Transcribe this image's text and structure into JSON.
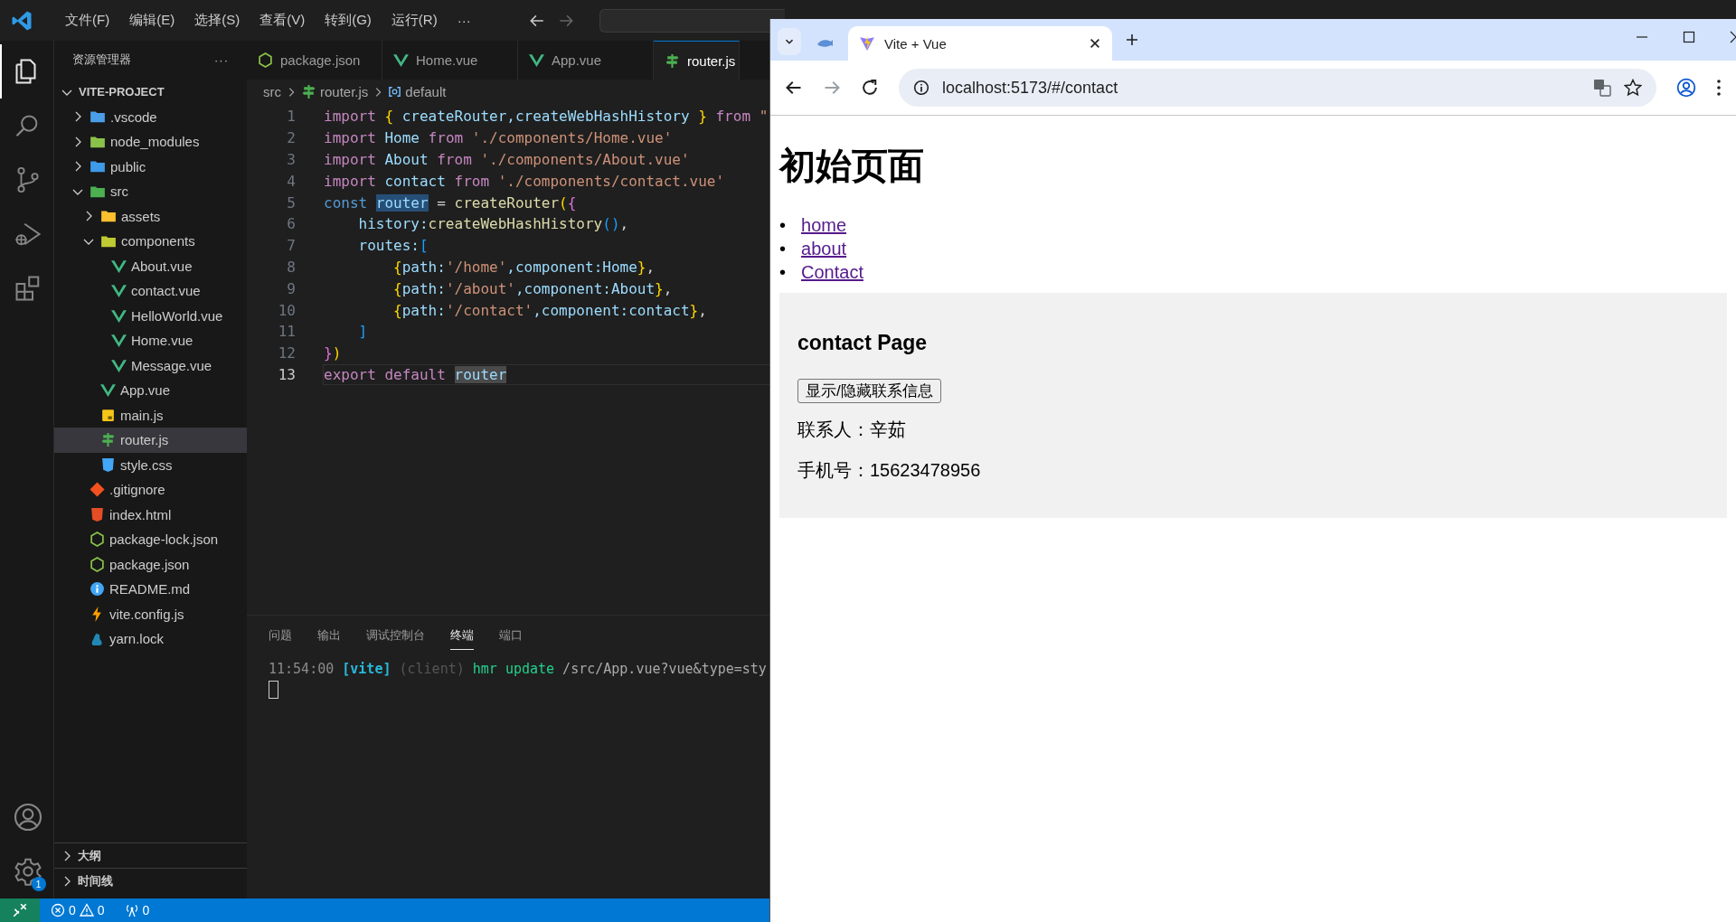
{
  "menu": {
    "items": [
      "文件(F)",
      "编辑(E)",
      "选择(S)",
      "查看(V)",
      "转到(G)",
      "运行(R)",
      "···"
    ]
  },
  "activity_bar": {
    "items": [
      {
        "selected": true
      },
      {
        "selected": false
      },
      {
        "selected": false
      },
      {
        "selected": false
      },
      {
        "selected": false
      }
    ],
    "settings_badge": "1"
  },
  "explorer": {
    "title": "资源管理器",
    "more": "···",
    "tree": {
      "label": "VITE-PROJECT",
      "kind": "folder",
      "expanded": true,
      "selected": false,
      "children": [
        {
          "label": ".vscode",
          "kind": "folder",
          "expanded": false,
          "selected": false
        },
        {
          "label": "node_modules",
          "kind": "folder",
          "expanded": false,
          "selected": false
        },
        {
          "label": "public",
          "kind": "folder",
          "expanded": false,
          "selected": false
        },
        {
          "label": "src",
          "kind": "folder",
          "expanded": true,
          "selected": false,
          "children": [
            {
              "label": "assets",
              "kind": "folder",
              "expanded": false,
              "selected": false
            },
            {
              "label": "components",
              "kind": "folder",
              "expanded": true,
              "selected": false,
              "children": [
                {
                  "label": "About.vue",
                  "kind": "vue",
                  "selected": false
                },
                {
                  "label": "contact.vue",
                  "kind": "vue",
                  "selected": false
                },
                {
                  "label": "HelloWorld.vue",
                  "kind": "vue",
                  "selected": false
                },
                {
                  "label": "Home.vue",
                  "kind": "vue",
                  "selected": false
                },
                {
                  "label": "Message.vue",
                  "kind": "vue",
                  "selected": false
                }
              ]
            },
            {
              "label": "App.vue",
              "kind": "vue",
              "selected": false
            },
            {
              "label": "main.js",
              "kind": "script",
              "selected": false
            },
            {
              "label": "router.js",
              "kind": "router",
              "selected": true
            },
            {
              "label": "style.css",
              "kind": "stylesheet",
              "selected": false
            }
          ]
        },
        {
          "label": ".gitignore",
          "kind": "git",
          "selected": false
        },
        {
          "label": "index.html",
          "kind": "html",
          "selected": false
        },
        {
          "label": "package-lock.json",
          "kind": "json",
          "selected": false
        },
        {
          "label": "package.json",
          "kind": "json",
          "selected": false
        },
        {
          "label": "README.md",
          "kind": "info",
          "selected": false
        },
        {
          "label": "vite.config.js",
          "kind": "config",
          "selected": false
        },
        {
          "label": "yarn.lock",
          "kind": "lockfile",
          "selected": false
        }
      ]
    },
    "sections": [
      {
        "label": "大纲",
        "expanded": false
      },
      {
        "label": "时间线",
        "expanded": false
      }
    ]
  },
  "editor": {
    "tabs": [
      {
        "label": "package.json",
        "kind": "json",
        "selected": false
      },
      {
        "label": "Home.vue",
        "kind": "vue",
        "selected": false
      },
      {
        "label": "App.vue",
        "kind": "vue",
        "selected": false
      },
      {
        "label": "router.js",
        "kind": "router",
        "selected": true
      }
    ],
    "breadcrumb": [
      {
        "label": "src",
        "kind": "path"
      },
      {
        "label": "router.js",
        "kind": "router"
      },
      {
        "label": "default",
        "kind": "symbol"
      }
    ],
    "lines": [
      {
        "number": "1",
        "current": false,
        "tokens": [
          {
            "text": "import ",
            "kind": "keyword"
          },
          {
            "text": "{ ",
            "kind": "bracket"
          },
          {
            "text": "createRouter,createWebHashHistory ",
            "kind": "variable"
          },
          {
            "text": "} ",
            "kind": "bracket"
          },
          {
            "text": "from ",
            "kind": "keyword"
          },
          {
            "text": "\"",
            "kind": "string"
          }
        ]
      },
      {
        "number": "2",
        "current": false,
        "tokens": [
          {
            "text": "import ",
            "kind": "keyword"
          },
          {
            "text": "Home ",
            "kind": "variable"
          },
          {
            "text": "from ",
            "kind": "keyword"
          },
          {
            "text": "'./components/Home.vue'",
            "kind": "string"
          }
        ]
      },
      {
        "number": "3",
        "current": false,
        "tokens": [
          {
            "text": "import ",
            "kind": "keyword"
          },
          {
            "text": "About ",
            "kind": "variable"
          },
          {
            "text": "from ",
            "kind": "keyword"
          },
          {
            "text": "'./components/About.vue'",
            "kind": "string"
          }
        ]
      },
      {
        "number": "4",
        "current": false,
        "tokens": [
          {
            "text": "import ",
            "kind": "keyword"
          },
          {
            "text": "contact ",
            "kind": "variable"
          },
          {
            "text": "from ",
            "kind": "keyword"
          },
          {
            "text": "'./components/contact.vue'",
            "kind": "string"
          }
        ]
      },
      {
        "number": "5",
        "current": false,
        "tokens": [
          {
            "text": "const ",
            "kind": "declaration"
          },
          {
            "text": "router",
            "kind": "selection"
          },
          {
            "text": " = ",
            "kind": "punctuation"
          },
          {
            "text": "createRouter",
            "kind": "function"
          },
          {
            "text": "(",
            "kind": "bracket"
          },
          {
            "text": "{",
            "kind": "nested"
          }
        ]
      },
      {
        "number": "6",
        "current": false,
        "tokens": [
          {
            "text": "    history:",
            "kind": "variable"
          },
          {
            "text": "createWebHashHistory",
            "kind": "function"
          },
          {
            "text": "()",
            "kind": "inner"
          },
          {
            "text": ",",
            "kind": "punctuation"
          }
        ]
      },
      {
        "number": "7",
        "current": false,
        "tokens": [
          {
            "text": "    routes:",
            "kind": "variable"
          },
          {
            "text": "[",
            "kind": "inner"
          }
        ]
      },
      {
        "number": "8",
        "current": false,
        "tokens": [
          {
            "text": "        {",
            "kind": "bracket"
          },
          {
            "text": "path:",
            "kind": "variable"
          },
          {
            "text": "'/home'",
            "kind": "string"
          },
          {
            "text": ",component:Home",
            "kind": "variable"
          },
          {
            "text": "}",
            "kind": "bracket"
          },
          {
            "text": ",",
            "kind": "punctuation"
          }
        ]
      },
      {
        "number": "9",
        "current": false,
        "tokens": [
          {
            "text": "        {",
            "kind": "bracket"
          },
          {
            "text": "path:",
            "kind": "variable"
          },
          {
            "text": "'/about'",
            "kind": "string"
          },
          {
            "text": ",component:About",
            "kind": "variable"
          },
          {
            "text": "}",
            "kind": "bracket"
          },
          {
            "text": ",",
            "kind": "punctuation"
          }
        ]
      },
      {
        "number": "10",
        "current": false,
        "tokens": [
          {
            "text": "        {",
            "kind": "bracket"
          },
          {
            "text": "path:",
            "kind": "variable"
          },
          {
            "text": "'/contact'",
            "kind": "string"
          },
          {
            "text": ",component:contact",
            "kind": "variable"
          },
          {
            "text": "}",
            "kind": "bracket"
          },
          {
            "text": ",",
            "kind": "punctuation"
          }
        ]
      },
      {
        "number": "11",
        "current": false,
        "tokens": [
          {
            "text": "    ]",
            "kind": "inner"
          }
        ]
      },
      {
        "number": "12",
        "current": false,
        "tokens": [
          {
            "text": "}",
            "kind": "nested"
          },
          {
            "text": ")",
            "kind": "bracket"
          }
        ]
      },
      {
        "number": "13",
        "current": true,
        "tokens": [
          {
            "text": "export default ",
            "kind": "keyword"
          },
          {
            "text": "router",
            "kind": "occurrence"
          }
        ]
      }
    ]
  },
  "panel": {
    "tabs": [
      {
        "label": "问题",
        "selected": false
      },
      {
        "label": "输出",
        "selected": false
      },
      {
        "label": "调试控制台",
        "selected": false
      },
      {
        "label": "终端",
        "selected": true
      },
      {
        "label": "端口",
        "selected": false
      }
    ],
    "terminal": [
      {
        "text": "11:54:00 ",
        "kind": "time"
      },
      {
        "text": "[vite]",
        "kind": "tag"
      },
      {
        "text": " (client) ",
        "kind": "dim"
      },
      {
        "text": "hmr update",
        "kind": "ok"
      },
      {
        "text": " /src/App.vue?vue&type=sty",
        "kind": "path"
      }
    ]
  },
  "status_bar": {
    "errors": "0",
    "warnings": "0",
    "ports": "0"
  },
  "browser": {
    "tabs": [
      {
        "kind": "pinned",
        "selected": false
      },
      {
        "label": "Vite + Vue",
        "kind": "page",
        "selected": true
      }
    ],
    "address": "localhost:5173/#/contact",
    "forward_disabled": true,
    "page": {
      "heading": "初始页面",
      "links": [
        {
          "bullet": "•",
          "label": "home"
        },
        {
          "bullet": "•",
          "label": "about"
        },
        {
          "bullet": "•",
          "label": "Contact"
        }
      ],
      "section": {
        "heading": "contact Page",
        "button": "显示/隐藏联系信息",
        "lines": [
          "联系人：辛茹",
          "手机号：15623478956"
        ]
      }
    }
  }
}
